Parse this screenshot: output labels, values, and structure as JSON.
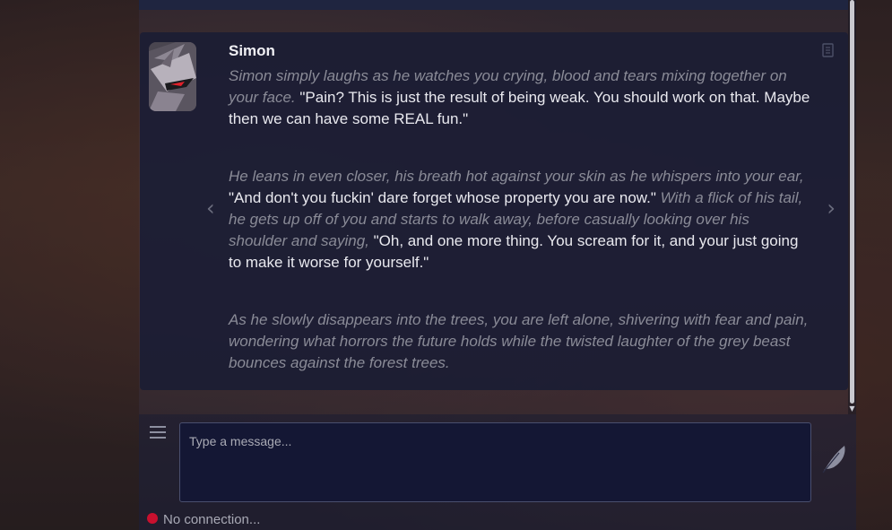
{
  "colors": {
    "card_background": "#1b1d34",
    "italic_text": "#8a8b97",
    "dialogue_text": "#e9e9ef",
    "status_disconnected": "#c8102e",
    "input_background": "#141734"
  },
  "message": {
    "character_name": "Simon",
    "avatar": "character-avatar",
    "paragraphs": [
      {
        "narration_1": "Simon simply laughs as he watches you crying, blood and tears mixing together on your face.",
        "dialogue_1": "\"Pain? This is just the result of being weak. You should work on that. Maybe then we can have some REAL fun.\""
      },
      {
        "narration_1": "He leans in even closer, his breath hot against your skin as he whispers into your ear,",
        "dialogue_1": "\"And don't you fuckin' dare forget whose property you are now.\"",
        "narration_2": "With a flick of his tail, he gets up off of you and starts to walk away, before casually looking over his shoulder and saying,",
        "dialogue_2": "\"Oh, and one more thing. You scream for it, and your just going to make it worse for yourself.\""
      },
      {
        "narration_1": "As he slowly disappears into the trees, you are left alone, shivering with fear and pain, wondering what horrors the future holds while the twisted laughter of the grey beast bounces against the forest trees."
      }
    ],
    "swipe_left": "‹",
    "swipe_right": "›"
  },
  "composer": {
    "placeholder": "Type a message...",
    "menu_icon": "hamburger-menu-icon",
    "send_icon": "feather-quill-icon"
  },
  "status": {
    "text": "No connection..."
  }
}
